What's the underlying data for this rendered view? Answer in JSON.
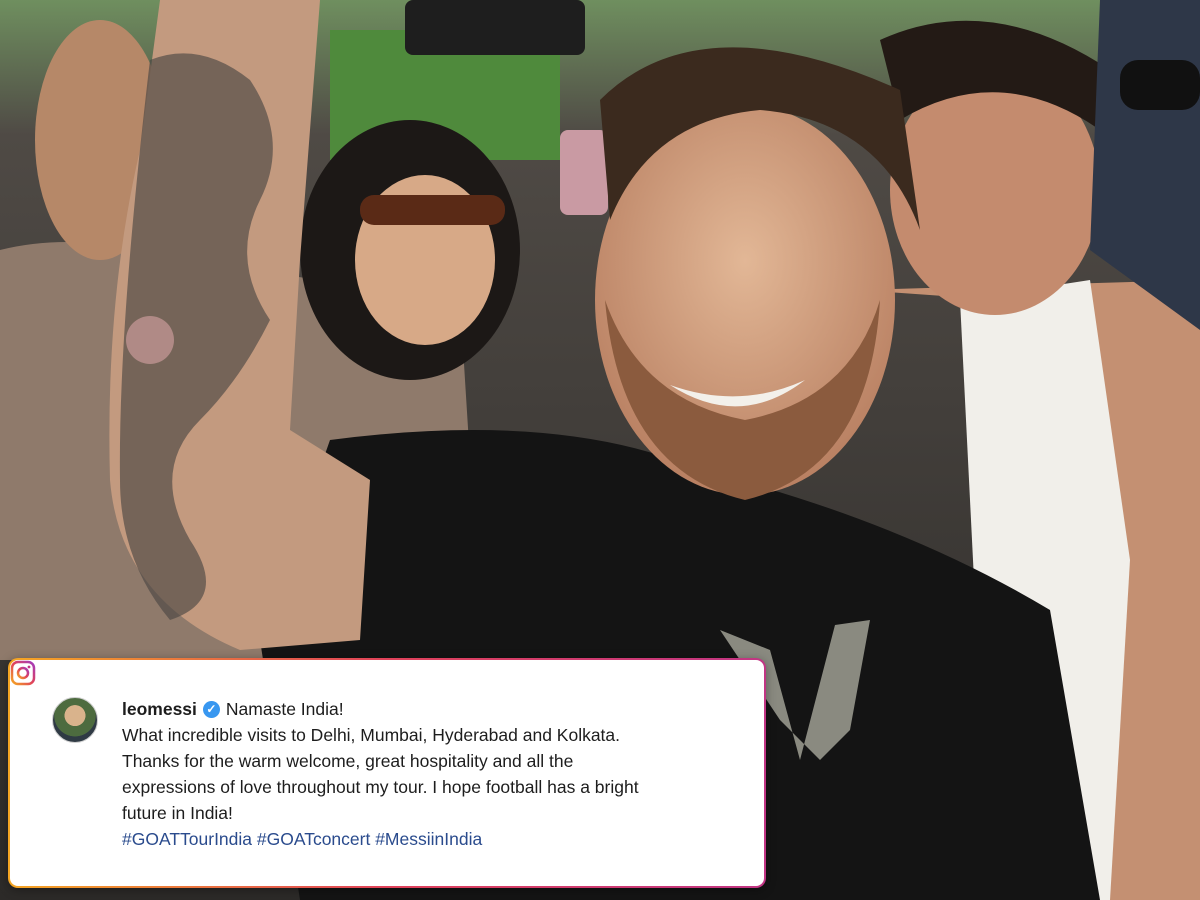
{
  "post": {
    "username": "leomessi",
    "verified_icon": "verified-badge-icon",
    "greeting": "Namaste India!",
    "lines": [
      "What incredible visits to Delhi, Mumbai, Hyderabad and Kolkata.",
      "Thanks for the warm welcome, great hospitality and all the",
      "expressions of love throughout my tour. I hope football has a bright",
      "future in India!"
    ],
    "hashtags": "#GOATTourIndia #GOATconcert #MessiinIndia",
    "platform_icon": "instagram-icon",
    "colors": {
      "hashtag": "#2a4b8d",
      "verified": "#3897f0",
      "border_start": "#f5a623",
      "border_end": "#c13584"
    }
  }
}
